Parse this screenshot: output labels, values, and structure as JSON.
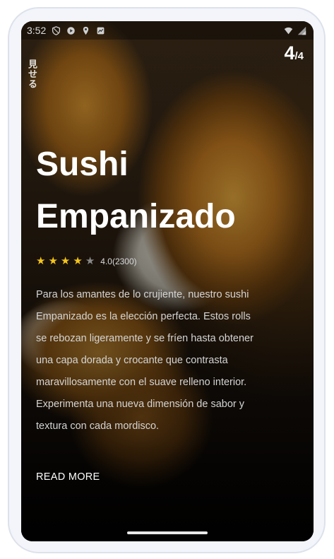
{
  "status_bar": {
    "time": "3:52",
    "left_icons": [
      "shield-icon",
      "play-icon",
      "location-icon",
      "notification-icon"
    ],
    "right_icons": [
      "wifi-icon",
      "signal-icon"
    ]
  },
  "pager": {
    "current": "4",
    "separator": "/",
    "total": "4"
  },
  "side_text": "見せる",
  "item": {
    "title": "Sushi Empanizado",
    "rating": {
      "stars_filled": 4,
      "stars_total": 5,
      "text": "4.0(2300)"
    },
    "description": "Para los amantes de lo crujiente, nuestro sushi Empanizado es la elección perfecta. Estos rolls se rebozan ligeramente y se fríen hasta obtener una capa dorada y crocante que contrasta maravillosamente con el suave relleno interior. Experimenta una nueva dimensión de sabor y textura con cada mordisco.",
    "read_more_label": "READ MORE"
  },
  "colors": {
    "star_filled": "#f5c518",
    "star_empty": "#8a8a8a",
    "text_primary": "#ffffff",
    "text_secondary": "#d4d4d4"
  }
}
